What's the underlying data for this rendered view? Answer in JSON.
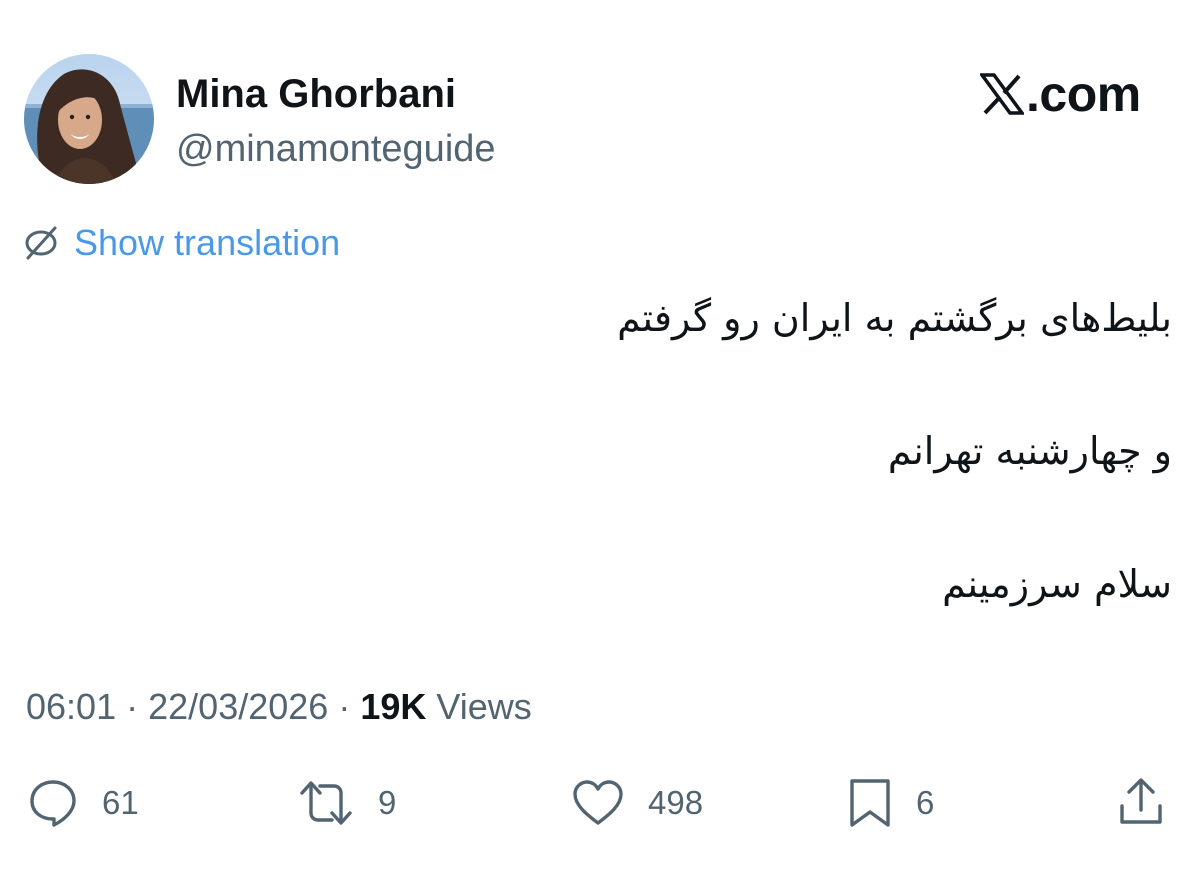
{
  "author": {
    "display_name": "Mina Ghorbani",
    "handle": "@minamonteguide",
    "avatar": "avatar-photo"
  },
  "brand": {
    "logo_icon": "x-logo-icon",
    "text": ".com"
  },
  "translation": {
    "icon": "globe-icon",
    "label": "Show translation"
  },
  "tweet": {
    "lines": [
      "بلیط‌های برگشتم به ایران رو گرفتم",
      "و چهارشنبه تهرانم",
      "سلام سرزمینم"
    ]
  },
  "meta": {
    "time": "06:01",
    "separator": "·",
    "date": "22/03/2026",
    "views_count": "19K",
    "views_label": "Views"
  },
  "actions": {
    "reply": {
      "icon": "reply-icon",
      "count": "61"
    },
    "retweet": {
      "icon": "retweet-icon",
      "count": "9"
    },
    "like": {
      "icon": "heart-icon",
      "count": "498"
    },
    "bookmark": {
      "icon": "bookmark-icon",
      "count": "6"
    },
    "share": {
      "icon": "share-icon"
    }
  },
  "colors": {
    "text_primary": "#0f1419",
    "text_secondary": "#536471",
    "link_blue": "#4a99e9",
    "background": "#ffffff"
  }
}
